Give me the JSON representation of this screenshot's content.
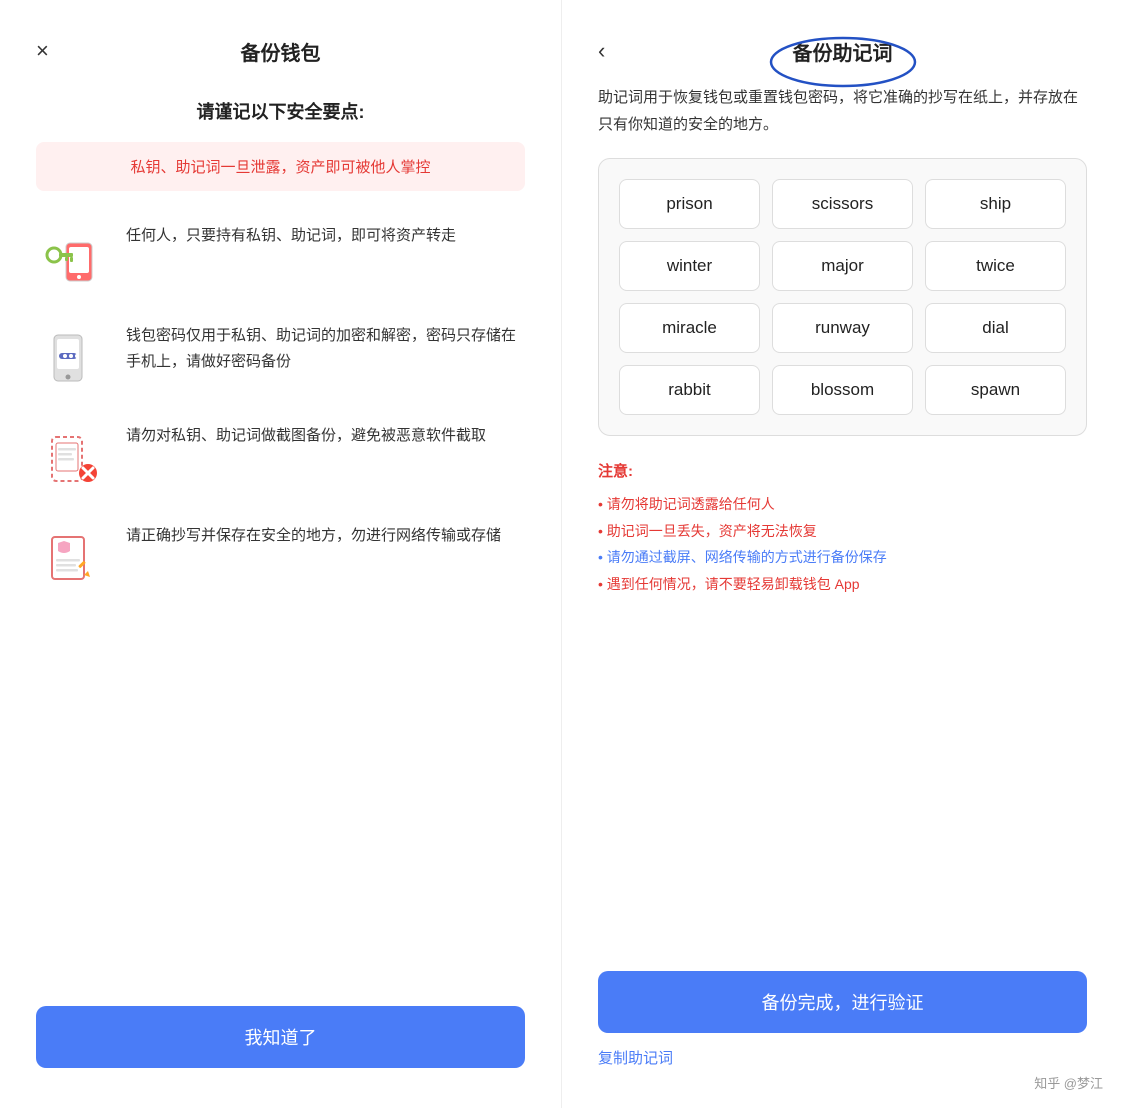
{
  "left": {
    "close_label": "×",
    "title": "备份钱包",
    "security_heading": "请谨记以下安全要点:",
    "warning": "私钥、助记词一旦泄露，资产即可被他人掌控",
    "items": [
      {
        "icon": "🔑📱",
        "text": "任何人，只要持有私钥、助记词，即可将资产转走"
      },
      {
        "icon": "📱",
        "text": "钱包密码仅用于私钥、助记词的加密和解密，密码只存储在手机上，请做好密码备份"
      },
      {
        "icon": "📸",
        "text": "请勿对私钥、助记词做截图备份，避免被恶意软件截取"
      },
      {
        "icon": "📄",
        "text": "请正确抄写并保存在安全的地方，勿进行网络传输或存储"
      }
    ],
    "confirm_button": "我知道了"
  },
  "right": {
    "back_label": "‹",
    "title": "备份助记词",
    "description": "助记词用于恢复钱包或重置钱包密码，将它准确的抄写在纸上，并存放在只有你知道的安全的地方。",
    "mnemonic_words": [
      "prison",
      "scissors",
      "ship",
      "winter",
      "major",
      "twice",
      "miracle",
      "runway",
      "dial",
      "rabbit",
      "blossom",
      "spawn"
    ],
    "notice_title": "注意:",
    "notices": [
      "• 请勿将助记词透露给任何人",
      "• 助记词一旦丢失，资产将无法恢复",
      "• 请勿通过截屏、网络传输的方式进行备份保存",
      "• 遇到任何情况，请不要轻易卸载钱包 App"
    ],
    "notice_colors": [
      "red",
      "red",
      "blue",
      "red"
    ],
    "verify_button": "备份完成，进行验证",
    "copy_button": "复制助记词"
  },
  "watermark": "知乎 @梦江"
}
